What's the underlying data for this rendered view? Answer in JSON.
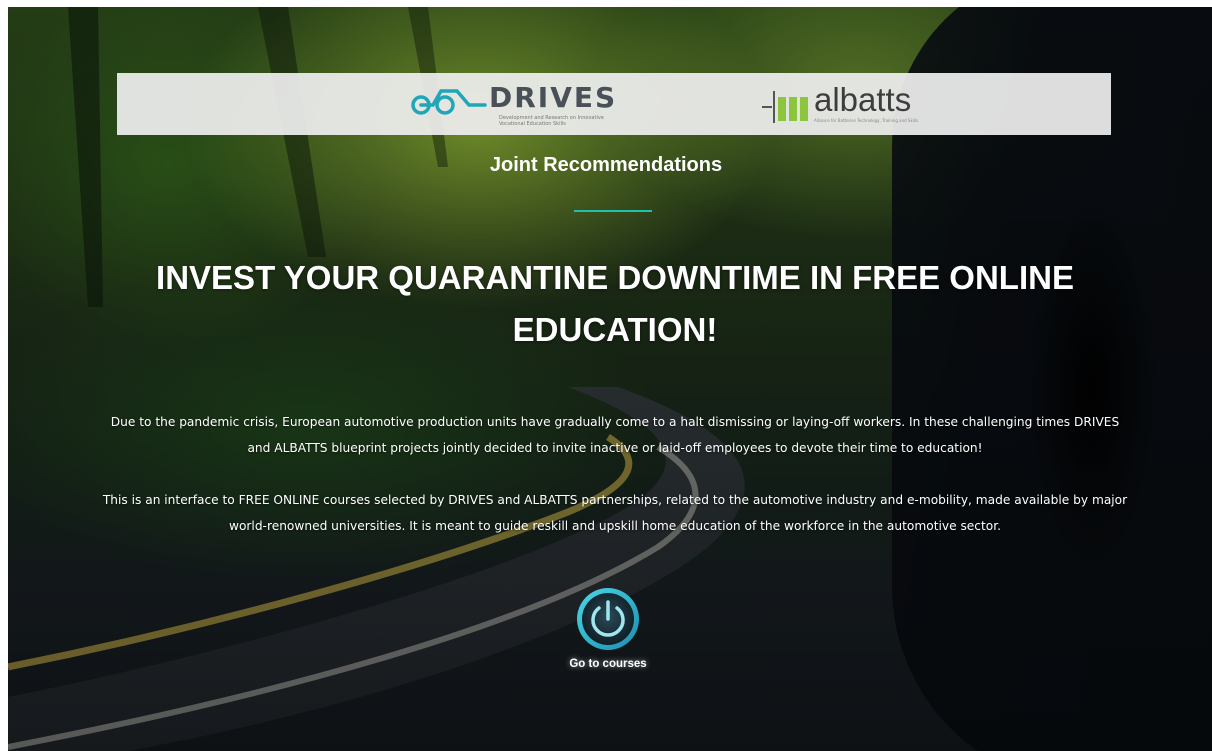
{
  "logos": {
    "drives": {
      "name": "DRIVES",
      "tagline": "Development and Research on Innovative Vocational Education Skills",
      "color": "#1fa6b8"
    },
    "albatts": {
      "name": "albatts",
      "tagline": "Alliance for Batteries Technology, Training and Skills",
      "color": "#8cc63e"
    }
  },
  "subtitle": "Joint Recommendations",
  "headline": "INVEST YOUR QUARANTINE DOWNTIME IN FREE ONLINE EDUCATION!",
  "paragraphs": [
    "Due to the pandemic crisis, European automotive production units have gradually come to a halt dismissing or laying-off workers. In these challenging times DRIVES and ALBATTS blueprint projects jointly decided to invite inactive or laid-off employees to devote their time to education!",
    "This is an interface to FREE ONLINE courses selected by DRIVES and ALBATTS partnerships, related to the automotive industry and e-mobility, made available by major world-renowned universities. It is meant to guide reskill and upskill home education of the workforce in the automotive sector."
  ],
  "cta": {
    "label": "Go to courses",
    "icon": "power-icon"
  },
  "colors": {
    "accent": "#22c0a8",
    "text": "#ffffff"
  }
}
